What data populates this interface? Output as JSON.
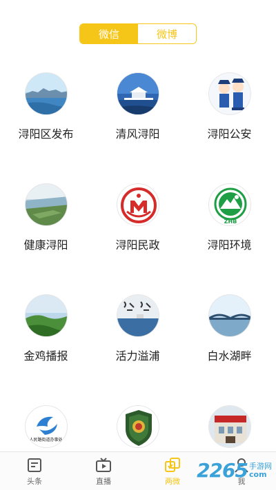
{
  "segment": {
    "options": [
      "微信",
      "微博"
    ],
    "active_index": 0
  },
  "accounts": [
    {
      "name": "浔阳区发布",
      "icon": "lake-city-icon"
    },
    {
      "name": "清风浔阳",
      "icon": "pavilion-icon"
    },
    {
      "name": "浔阳公安",
      "icon": "police-cartoon-icon"
    },
    {
      "name": "健康浔阳",
      "icon": "river-aerial-icon"
    },
    {
      "name": "浔阳民政",
      "icon": "civil-affairs-emblem-icon"
    },
    {
      "name": "浔阳环境",
      "icon": "environment-zhb-emblem-icon"
    },
    {
      "name": "金鸡播报",
      "icon": "green-landscape-icon"
    },
    {
      "name": "活力溢浦",
      "icon": "calligraphy-lake-icon"
    },
    {
      "name": "白水湖畔",
      "icon": "bridge-icon"
    },
    {
      "name": "",
      "icon": "street-office-logo-icon",
      "logo_text": "人民路街道办事处"
    },
    {
      "name": "",
      "icon": "market-supervision-badge-icon"
    },
    {
      "name": "",
      "icon": "building-photo-icon"
    }
  ],
  "tabbar": {
    "items": [
      {
        "label": "头条",
        "icon": "headline-icon"
      },
      {
        "label": "直播",
        "icon": "live-tv-icon"
      },
      {
        "label": "两微",
        "icon": "two-micro-icon"
      },
      {
        "label": "我",
        "icon": "me-icon"
      }
    ],
    "active_index": 2
  },
  "watermark": {
    "number": "2265",
    "suffix": "com",
    "site": "手游网"
  },
  "colors": {
    "accent": "#f5c518",
    "text": "#222222",
    "watermark": "#3aa2d9"
  }
}
